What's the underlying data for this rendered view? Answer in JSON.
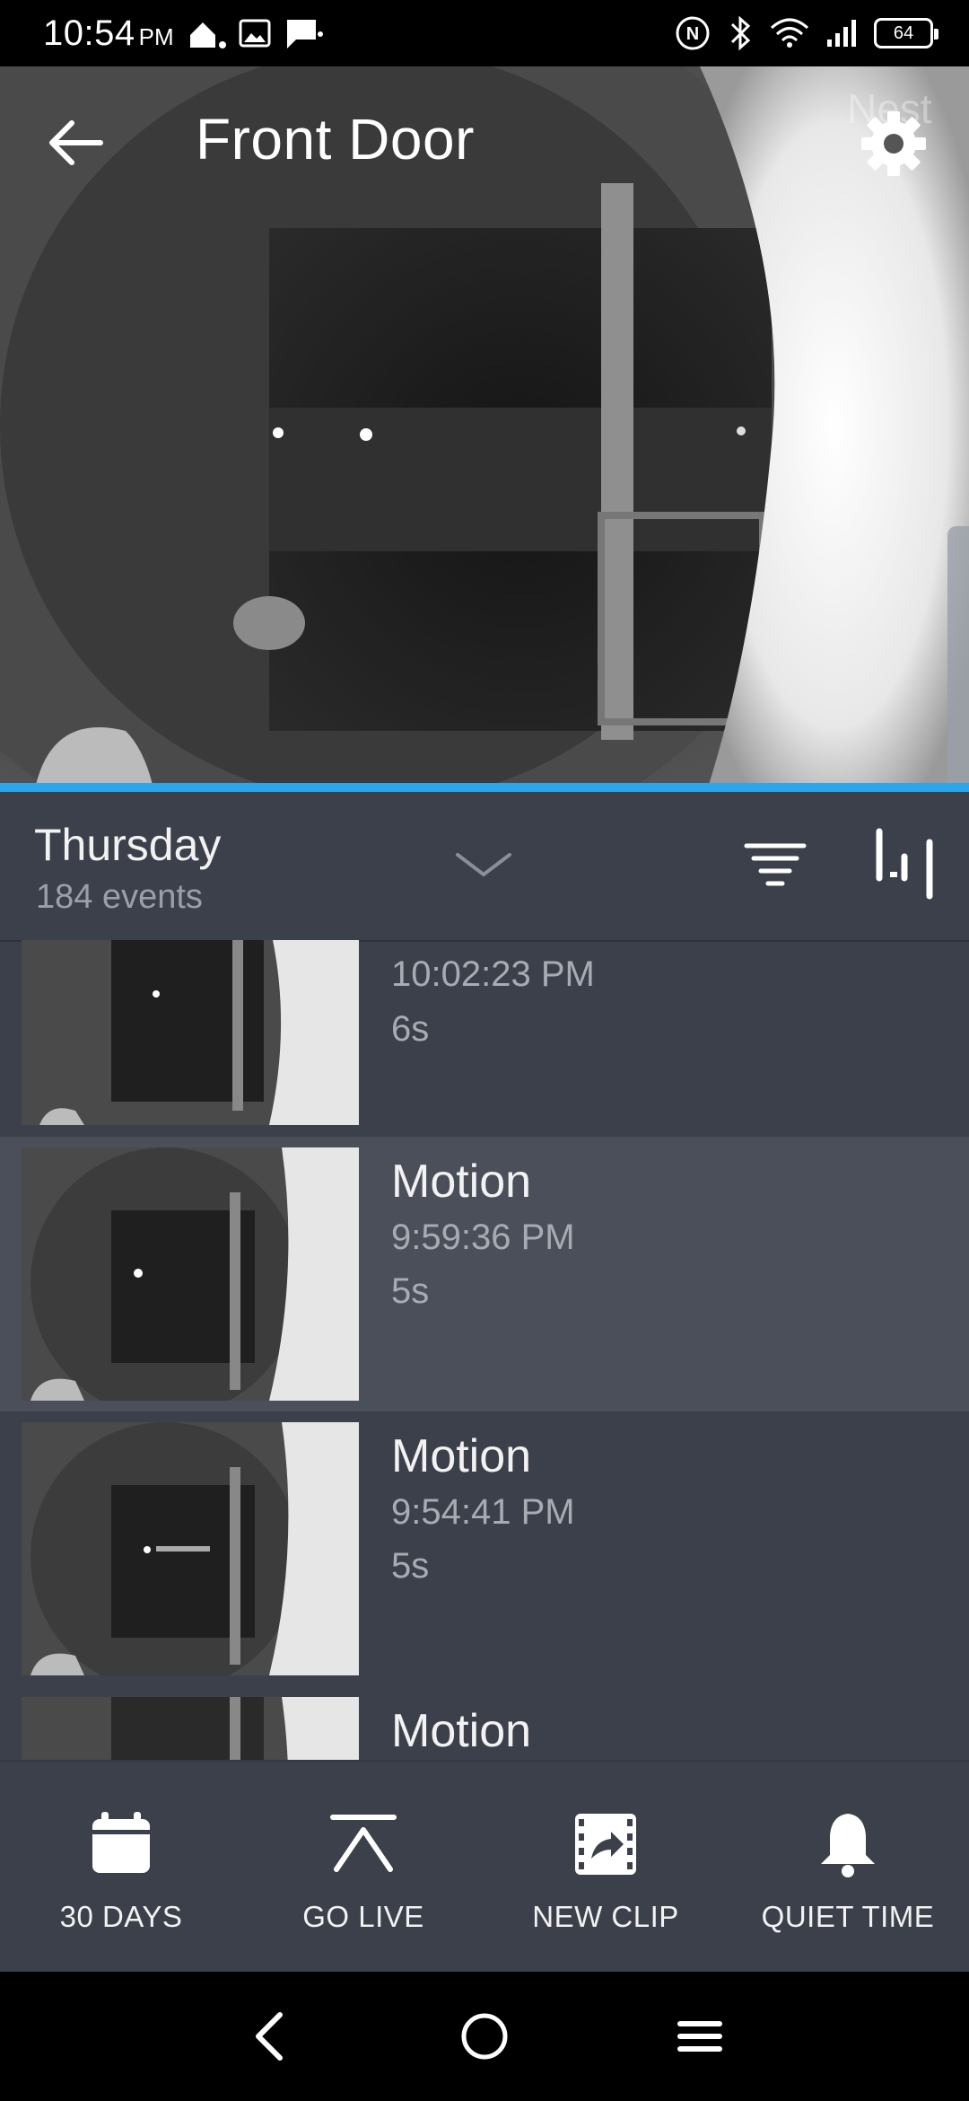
{
  "status_bar": {
    "time": "10:54",
    "ampm": "PM",
    "battery": "64"
  },
  "header": {
    "title": "Front Door",
    "watermark": "Nest"
  },
  "day": {
    "name": "Thursday",
    "count": "184 events"
  },
  "events": [
    {
      "title": "",
      "time": "10:02:23 PM",
      "duration": "6s",
      "selected": false
    },
    {
      "title": "Motion",
      "time": "9:59:36 PM",
      "duration": "5s",
      "selected": true
    },
    {
      "title": "Motion",
      "time": "9:54:41 PM",
      "duration": "5s",
      "selected": false
    },
    {
      "title": "Motion",
      "time": "",
      "duration": "",
      "selected": false
    }
  ],
  "actions": {
    "days": "30 DAYS",
    "live": "GO LIVE",
    "clip": "NEW CLIP",
    "quiet": "QUIET TIME"
  },
  "colors": {
    "accent": "#2aa6ea",
    "list_bg": "#3b404b",
    "selected_bg": "#4a4f5a"
  }
}
